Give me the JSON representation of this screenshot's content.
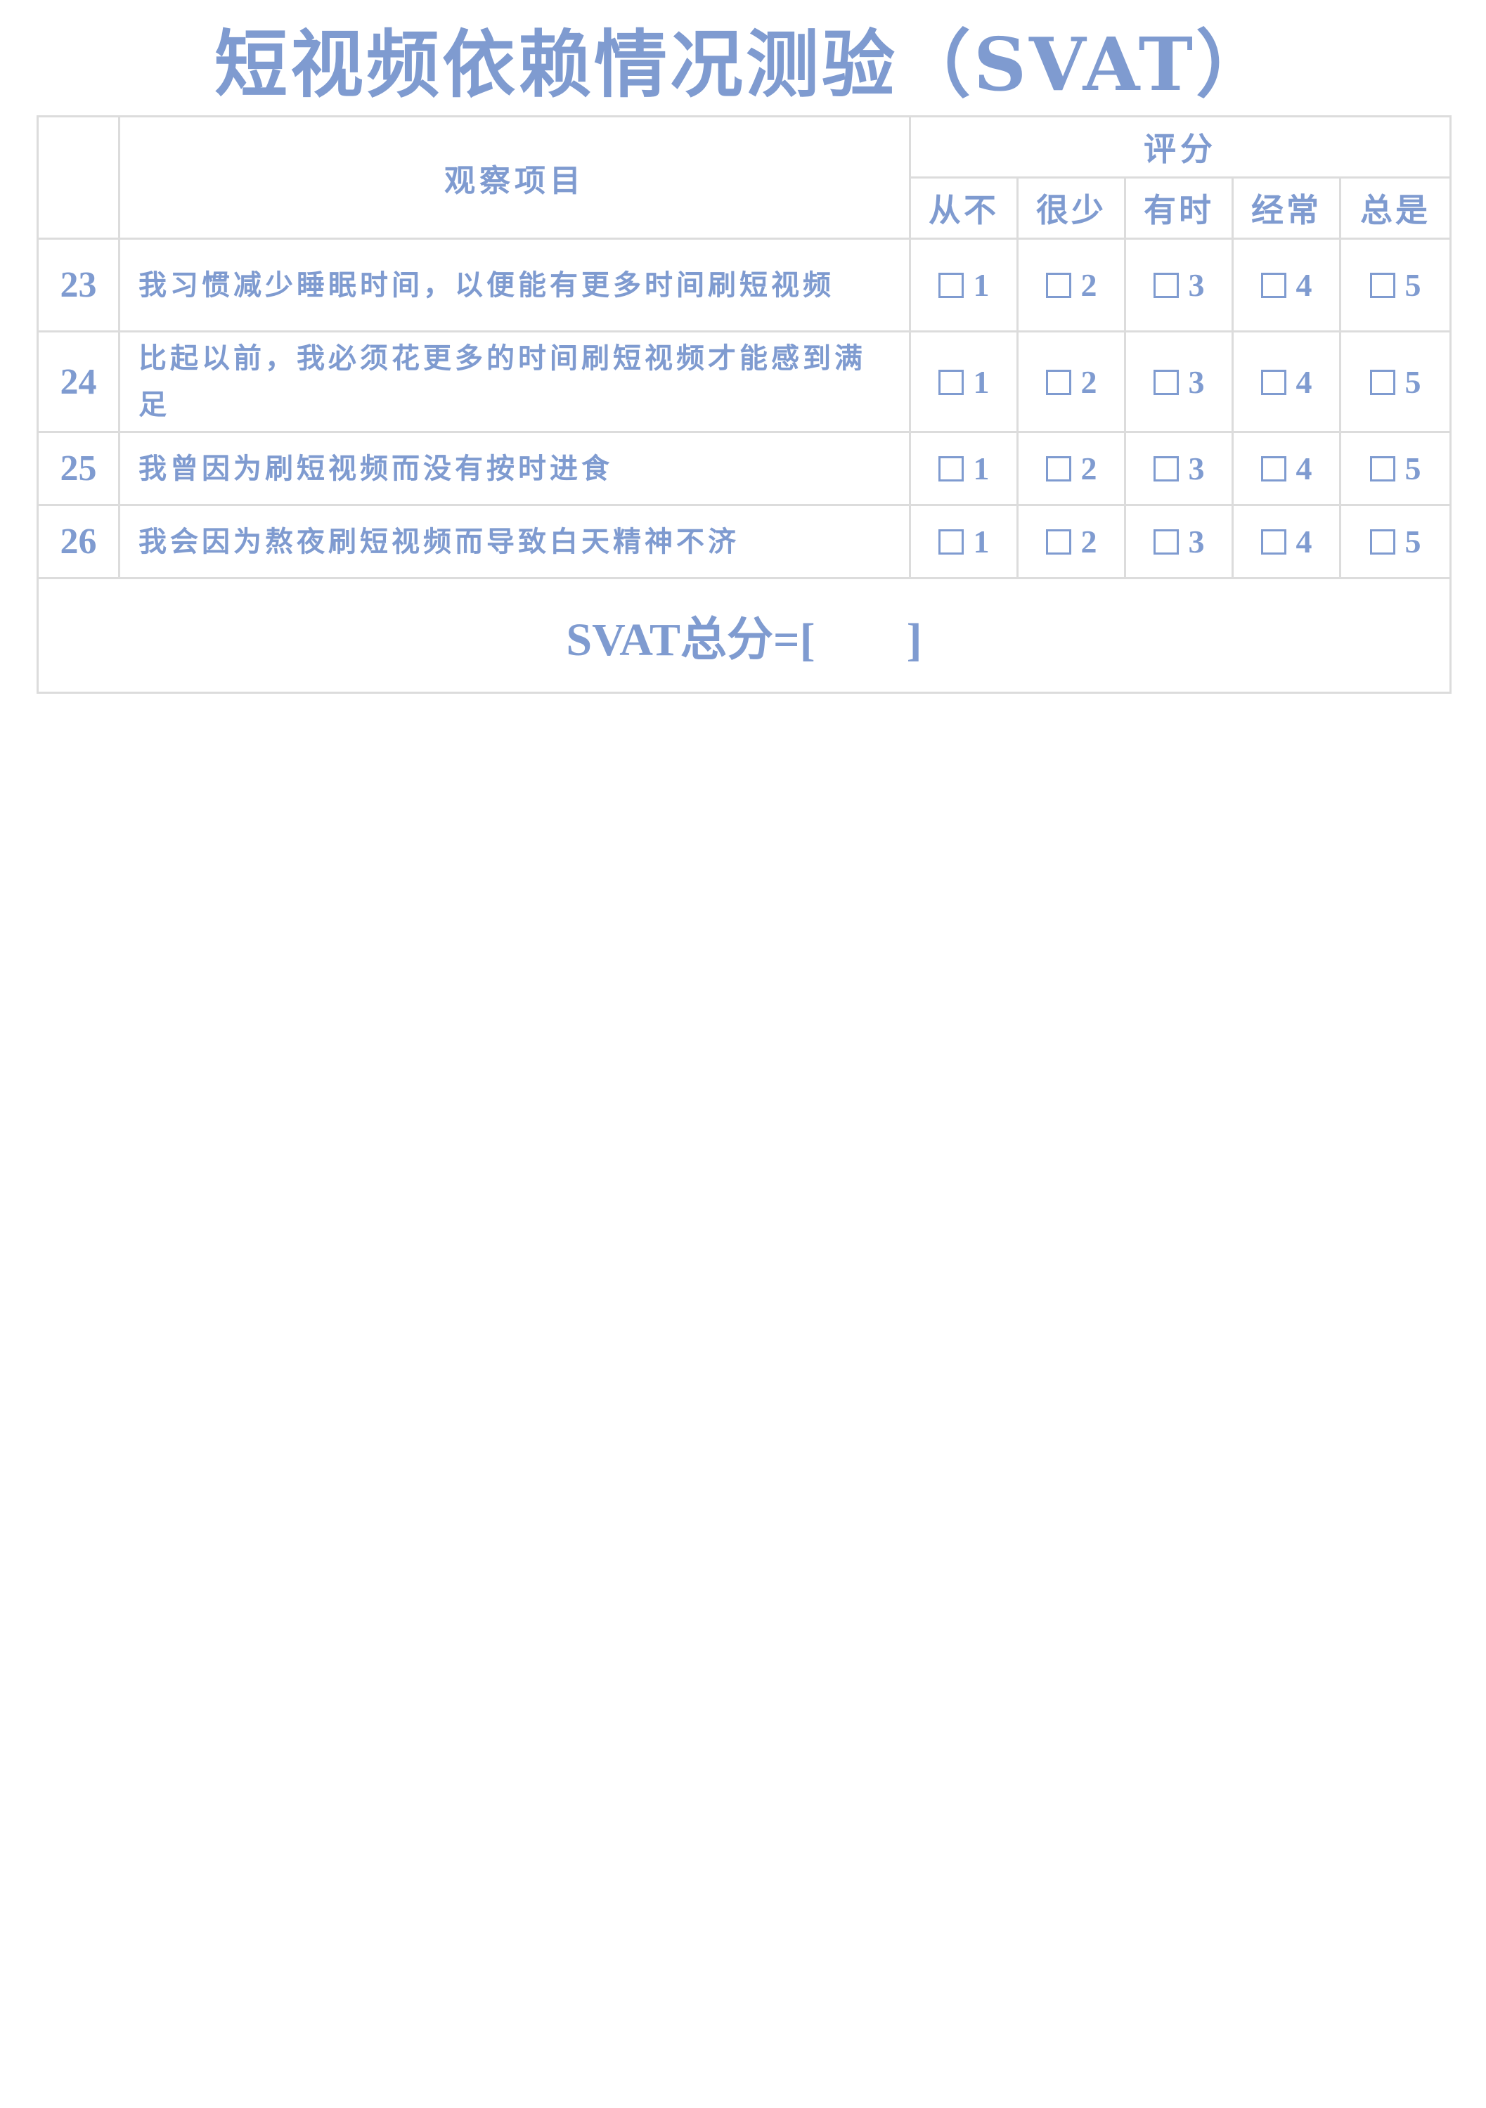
{
  "title": "短视频依赖情况测验（SVAT）",
  "header": {
    "item_label": "观察项目",
    "score_label": "评分",
    "options": [
      "从不",
      "很少",
      "有时",
      "经常",
      "总是"
    ]
  },
  "rows": [
    {
      "num": "23",
      "text": "我习惯减少睡眠时间，以便能有更多时间刷短视频",
      "choices": [
        "1",
        "2",
        "3",
        "4",
        "5"
      ]
    },
    {
      "num": "24",
      "text": "比起以前，我必须花更多的时间刷短视频才能感到满足",
      "choices": [
        "1",
        "2",
        "3",
        "4",
        "5"
      ]
    },
    {
      "num": "25",
      "text": "我曾因为刷短视频而没有按时进食",
      "choices": [
        "1",
        "2",
        "3",
        "4",
        "5"
      ]
    },
    {
      "num": "26",
      "text": "我会因为熬夜刷短视频而导致白天精神不济",
      "choices": [
        "1",
        "2",
        "3",
        "4",
        "5"
      ]
    }
  ],
  "total": {
    "label": "SVAT总分=[",
    "close": "]"
  },
  "colors": {
    "text": "#7f9bd0",
    "border": "#dcdcdc"
  }
}
